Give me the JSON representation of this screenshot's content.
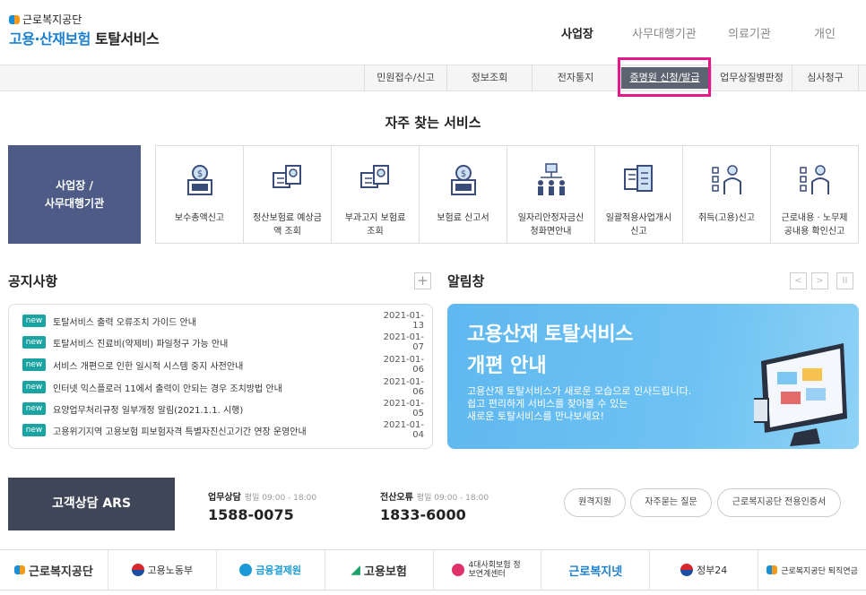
{
  "header": {
    "logo_top": "근로복지공단",
    "logo_main_blue": "고용·산재보험",
    "logo_main_dark": "토탈서비스",
    "nav": [
      "사업장",
      "사무대행기관",
      "의료기관",
      "개인"
    ]
  },
  "subnav": [
    "민원접수/신고",
    "정보조회",
    "전자통지",
    "증명원 신청/발급",
    "업무상질병판정",
    "심사청구"
  ],
  "frequent": {
    "title": "자주 찾는 서비스",
    "category_line1": "사업장 /",
    "category_line2": "사무대행기관",
    "items": [
      {
        "line1": "보수총액신고",
        "line2": ""
      },
      {
        "line1": "정산보험료 예상금",
        "line2": "액 조회"
      },
      {
        "line1": "부과고지 보험료",
        "line2": "조회"
      },
      {
        "line1": "보험료 신고서",
        "line2": ""
      },
      {
        "line1": "일자리안정자금신",
        "line2": "청화면안내"
      },
      {
        "line1": "일괄적용사업개시",
        "line2": "신고"
      },
      {
        "line1": "취득(고용)신고",
        "line2": ""
      },
      {
        "line1": "근로내용 · 노무제",
        "line2": "공내용 확인신고"
      }
    ]
  },
  "notice": {
    "title": "공지사항",
    "plus": "+",
    "badge": "new",
    "items": [
      {
        "text": "토탈서비스 출력 오류조치 가이드 안내",
        "date": "2021-01-13"
      },
      {
        "text": "토탈서비스 진료비(약제비) 파일청구 가능 안내",
        "date": "2021-01-07"
      },
      {
        "text": "서비스 개편으로 인한 일시적 시스템 중지 사전안내",
        "date": "2021-01-06"
      },
      {
        "text": "인터넷 익스플로러 11에서 출력이 안되는 경우 조치방법 안내",
        "date": "2021-01-06"
      },
      {
        "text": "요양업무처리규정 일부개정 알림(2021.1.1. 시행)",
        "date": "2021-01-05"
      },
      {
        "text": "고용위기지역 고용보험 피보험자격 특별자진신고기간 연장 운영안내",
        "date": "2021-01-04"
      }
    ]
  },
  "alert": {
    "title": "알림창",
    "controls": [
      "<",
      ">",
      "II"
    ],
    "banner_title1": "고용산재 토탈서비스",
    "banner_title2": "개편 안내",
    "banner_line1": "고용산재 토탈서비스가 새로운 모습으로 인사드립니다.",
    "banner_line2": "쉽고 편리하게 서비스를 찾아볼 수 있는",
    "banner_line3": "새로운 토탈서비스를 만나보세요!"
  },
  "ars": {
    "title": "고객상담 ARS",
    "work_label": "업무상담",
    "work_hours": "평일 09:00 - 18:00",
    "work_number": "1588-0075",
    "it_label": "전산오류",
    "it_hours": "평일 09:00 - 18:00",
    "it_number": "1833-6000",
    "buttons": [
      "원격지원",
      "자주묻는 질문",
      "근로복지공단 전용인증서"
    ]
  },
  "footer": [
    {
      "text": "근로복지공단",
      "color": "#1b8fd6"
    },
    {
      "text": "고용노동부",
      "color": "#d9262c"
    },
    {
      "text": "금융결제원",
      "color": "#1a9ad6"
    },
    {
      "text": "고용보험",
      "color": "#1aa36a"
    },
    {
      "text": "4대사회보험 정보연계센터",
      "color": "#e0316b"
    },
    {
      "text": "근로복지넷",
      "color": "#1a7fd0"
    },
    {
      "text": "정부24",
      "color": "#1a5bbf"
    },
    {
      "text": "근로복지공단 퇴직연금",
      "color": "#e85a2a"
    }
  ]
}
